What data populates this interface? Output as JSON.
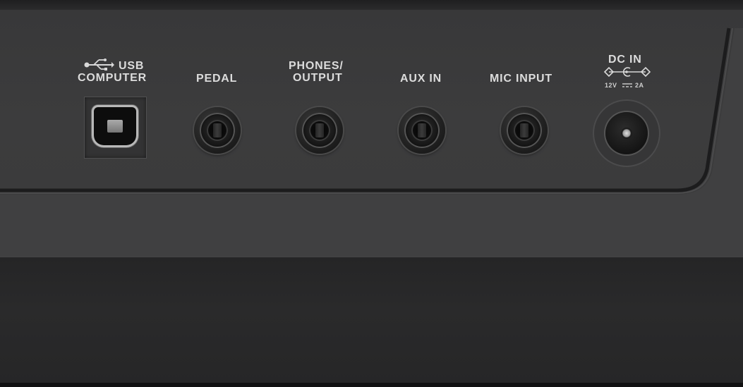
{
  "ports": {
    "usb": {
      "line1": "USB",
      "line2": "COMPUTER"
    },
    "pedal": {
      "label": "PEDAL"
    },
    "phones": {
      "line1": "PHONES/",
      "line2": "OUTPUT"
    },
    "aux": {
      "label": "AUX IN"
    },
    "mic": {
      "label": "MIC INPUT"
    },
    "dc": {
      "label": "DC IN",
      "rating_left": "12V",
      "rating_right": "2A"
    }
  },
  "icons": {
    "usb": "usb-trident-icon",
    "dc_polarity": "dc-polarity-icon",
    "dc_current": "direct-current-icon"
  },
  "colors": {
    "panel": "#3a3a3b",
    "lower_body": "#262627",
    "label_text": "#dcdcdc"
  }
}
